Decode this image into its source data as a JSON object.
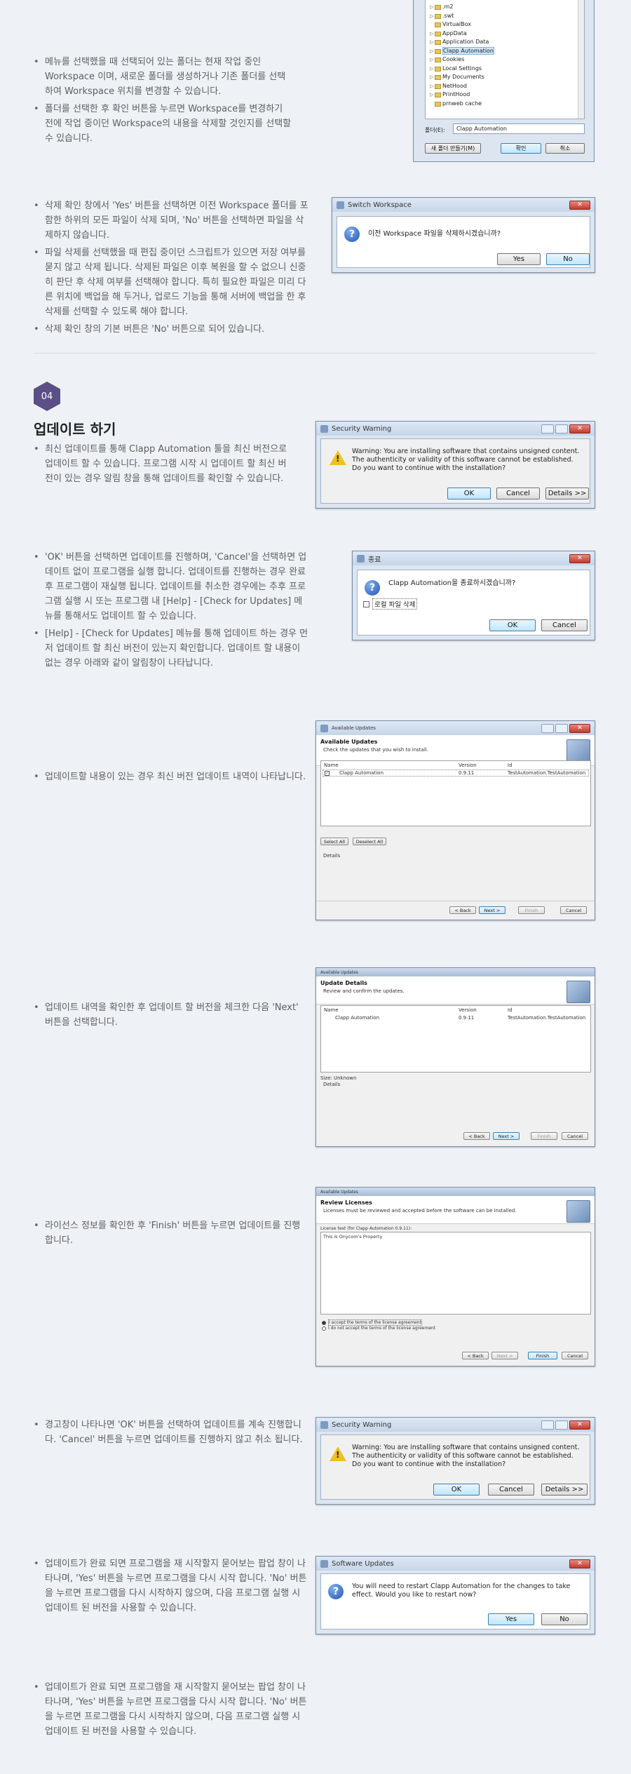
{
  "section1": {
    "bullets": [
      "메뉴를 선택했을 때 선택되어 있는 폴더는 현재 작업 중인 Workspace 이며, 새로운 폴더를 생성하거나 기존 폴더를 선택하여 Workspace 위치를 변경할 수 있습니다.",
      "폴더를 선택한 후 확인 버튼을 누르면 Workspace를 변경하기 전에 작업 중이던 Workspace의 내용을 삭제할 것인지를 선택할 수 있습니다."
    ]
  },
  "folder_dialog": {
    "tree": [
      ".m2",
      ".swt",
      "VirtualBox",
      "AppData",
      "Application Data",
      "Clapp Automation",
      "Cookies",
      "Local Settings",
      "My Documents",
      "NetHood",
      "PrintHood",
      "prnweb cache"
    ],
    "selected": "Clapp Automation",
    "folder_label": "폴더(E):",
    "folder_value": "Clapp Automation",
    "new_folder_btn": "새 폴더 만들기(M)",
    "ok_btn": "확인",
    "cancel_btn": "취소"
  },
  "section2": {
    "bullets": [
      "삭제 확인 창에서 'Yes' 버튼을 선택하면 이전 Workspace 폴더를 포함한 하위의 모든 파일이 삭제 되며, 'No' 버튼을 선택하면 파일을 삭제하지 않습니다.",
      "파일 삭제를 선택했을 때 편집 중이던 스크립트가 있으면 저장 여부를 묻지 않고 삭제 됩니다. 삭제된 파일은 이후 복원을 할 수 없으니 신중히 판단 후 삭제 여부를 선택해야 합니다. 특히 필요한 파일은 미리 다른 위치에 백업을 해 두거나, 업로드 기능을 통해 서버에 백업을 한 후 삭제를 선택할 수 있도록 해야 합니다.",
      "삭제 확인 창의 기본 버튼은 'No' 버튼으로 되어 있습니다."
    ]
  },
  "switch_dialog": {
    "title": "Switch Workspace",
    "message": "이전 Workspace 파일을 삭제하시겠습니까?",
    "yes": "Yes",
    "no": "No"
  },
  "section3": {
    "number": "04",
    "heading": "업데이트 하기",
    "bullets": [
      "최신 업데이트를 통해 Clapp Automation 툴을 최신 버전으로 업데이트 할 수 있습니다. 프로그램 시작 시 업데이트 할 최신 버전이 있는 경우 알림 창을 통해 업데이트를 확인할 수 있습니다."
    ]
  },
  "security_dialog": {
    "title": "Security Warning",
    "message": "Warning: You are installing software that contains unsigned content. The authenticity or validity of this software cannot be established. Do you want to continue with the installation?",
    "ok": "OK",
    "cancel": "Cancel",
    "details": "Details >>"
  },
  "section4": {
    "bullets": [
      "'OK' 버튼을 선택하면 업데이트를 진행하며, 'Cancel'을 선택하면 업데이트 없이 프로그램을 실행 합니다. 업데이트를 진행하는 경우 완료 후 프로그램이 재실행 됩니다. 업데이트를 취소한 경우에는 추후 프로그램 실행 시 또는 프로그램 내 [Help] - [Check for Updates] 메뉴를 통해서도 업데이트 할 수 있습니다.",
      "[Help] - [Check for Updates] 메뉴를 통해 업데이트 하는 경우 먼저 업데이트 할 최신 버전이 있는지 확인합니다. 업데이트 할 내용이 없는 경우 아래와 같이 알림창이 나타납니다."
    ]
  },
  "exit_dialog": {
    "title": "종료",
    "message": "Clapp Automation을 종료하시겠습니까?",
    "checkbox": "로컬 파일 삭제",
    "ok": "OK",
    "cancel": "Cancel"
  },
  "section5": {
    "bullets": [
      "업데이트할 내용이 있는 경우 최신 버전 업데이트 내역이 나타납니다."
    ]
  },
  "avail_dialog": {
    "title": "Available Updates",
    "heading": "Available Updates",
    "sub": "Check the updates that you wish to install.",
    "cols": [
      "Name",
      "Version",
      "Id"
    ],
    "row": [
      "Clapp Automation",
      "0.9.11",
      "TestAutomation.TestAutomation"
    ],
    "select_all": "Select All",
    "deselect_all": "Deselect All",
    "details": "Details",
    "back": "< Back",
    "next": "Next >",
    "finish": "Finish",
    "cancel": "Cancel"
  },
  "section6": {
    "bullets": [
      "업데이트 내역을 확인한 후 업데이트 할 버전을 체크한 다음 'Next' 버튼을 선택합니다."
    ]
  },
  "details_dialog": {
    "title": "Available Updates",
    "heading": "Update Details",
    "sub": "Review and confirm the updates.",
    "cols": [
      "Name",
      "Version",
      "Id"
    ],
    "row": [
      "Clapp Automation",
      "0.9.11",
      "TestAutomation.TestAutomation"
    ],
    "size": "Size: Unknown",
    "details": "Details",
    "back": "< Back",
    "next": "Next >",
    "finish": "Finish",
    "cancel": "Cancel"
  },
  "section7": {
    "bullets": [
      "라이선스 정보를 확인한 후 'Finish' 버튼을 누르면 업데이트를 진행 합니다."
    ]
  },
  "license_dialog": {
    "title": "Available Updates",
    "heading": "Review Licenses",
    "sub": "Licenses must be reviewed and accepted before the software can be installed.",
    "license_label": "License text (for Clapp Automation 0.9.11):",
    "license_text": "This is Onycom's Property",
    "accept": "I accept the terms of the license agreement",
    "decline": "I do not accept the terms of the license agreement",
    "back": "< Back",
    "next": "Next >",
    "finish": "Finish",
    "cancel": "Cancel"
  },
  "section8": {
    "bullets": [
      "경고창이 나타나면 'OK' 버튼을 선택하여 업데이트를 계속 진행합니다. 'Cancel' 버튼을 누르면 업데이트를 진행하지 않고 취소 됩니다."
    ]
  },
  "section9": {
    "bullets": [
      "업데이트가 완료 되면 프로그램을 재 시작할지 묻어보는 팝업 창이 나타나며, 'Yes' 버튼을 누르면 프로그램을 다시 시작 합니다. 'No' 버튼을 누르면 프로그램을 다시 시작하지 않으며, 다음 프로그램 실행 시 업데이트 된 버전을 사용할 수 있습니다."
    ]
  },
  "restart_dialog": {
    "title": "Software Updates",
    "message": "You will need to restart Clapp Automation for the changes to take effect. Would you like to restart now?",
    "yes": "Yes",
    "no": "No"
  },
  "section10": {
    "bullets": [
      "업데이트가 완료 되면 프로그램을 재 시작할지 묻어보는 팝업 창이 나타나며, 'Yes' 버튼을 누르면 프로그램을 다시 시작 합니다. 'No' 버튼을 누르면 프로그램을 다시 시작하지 않으며, 다음 프로그램 실행 시 업데이트 된 버전을 사용할 수 있습니다."
    ]
  }
}
